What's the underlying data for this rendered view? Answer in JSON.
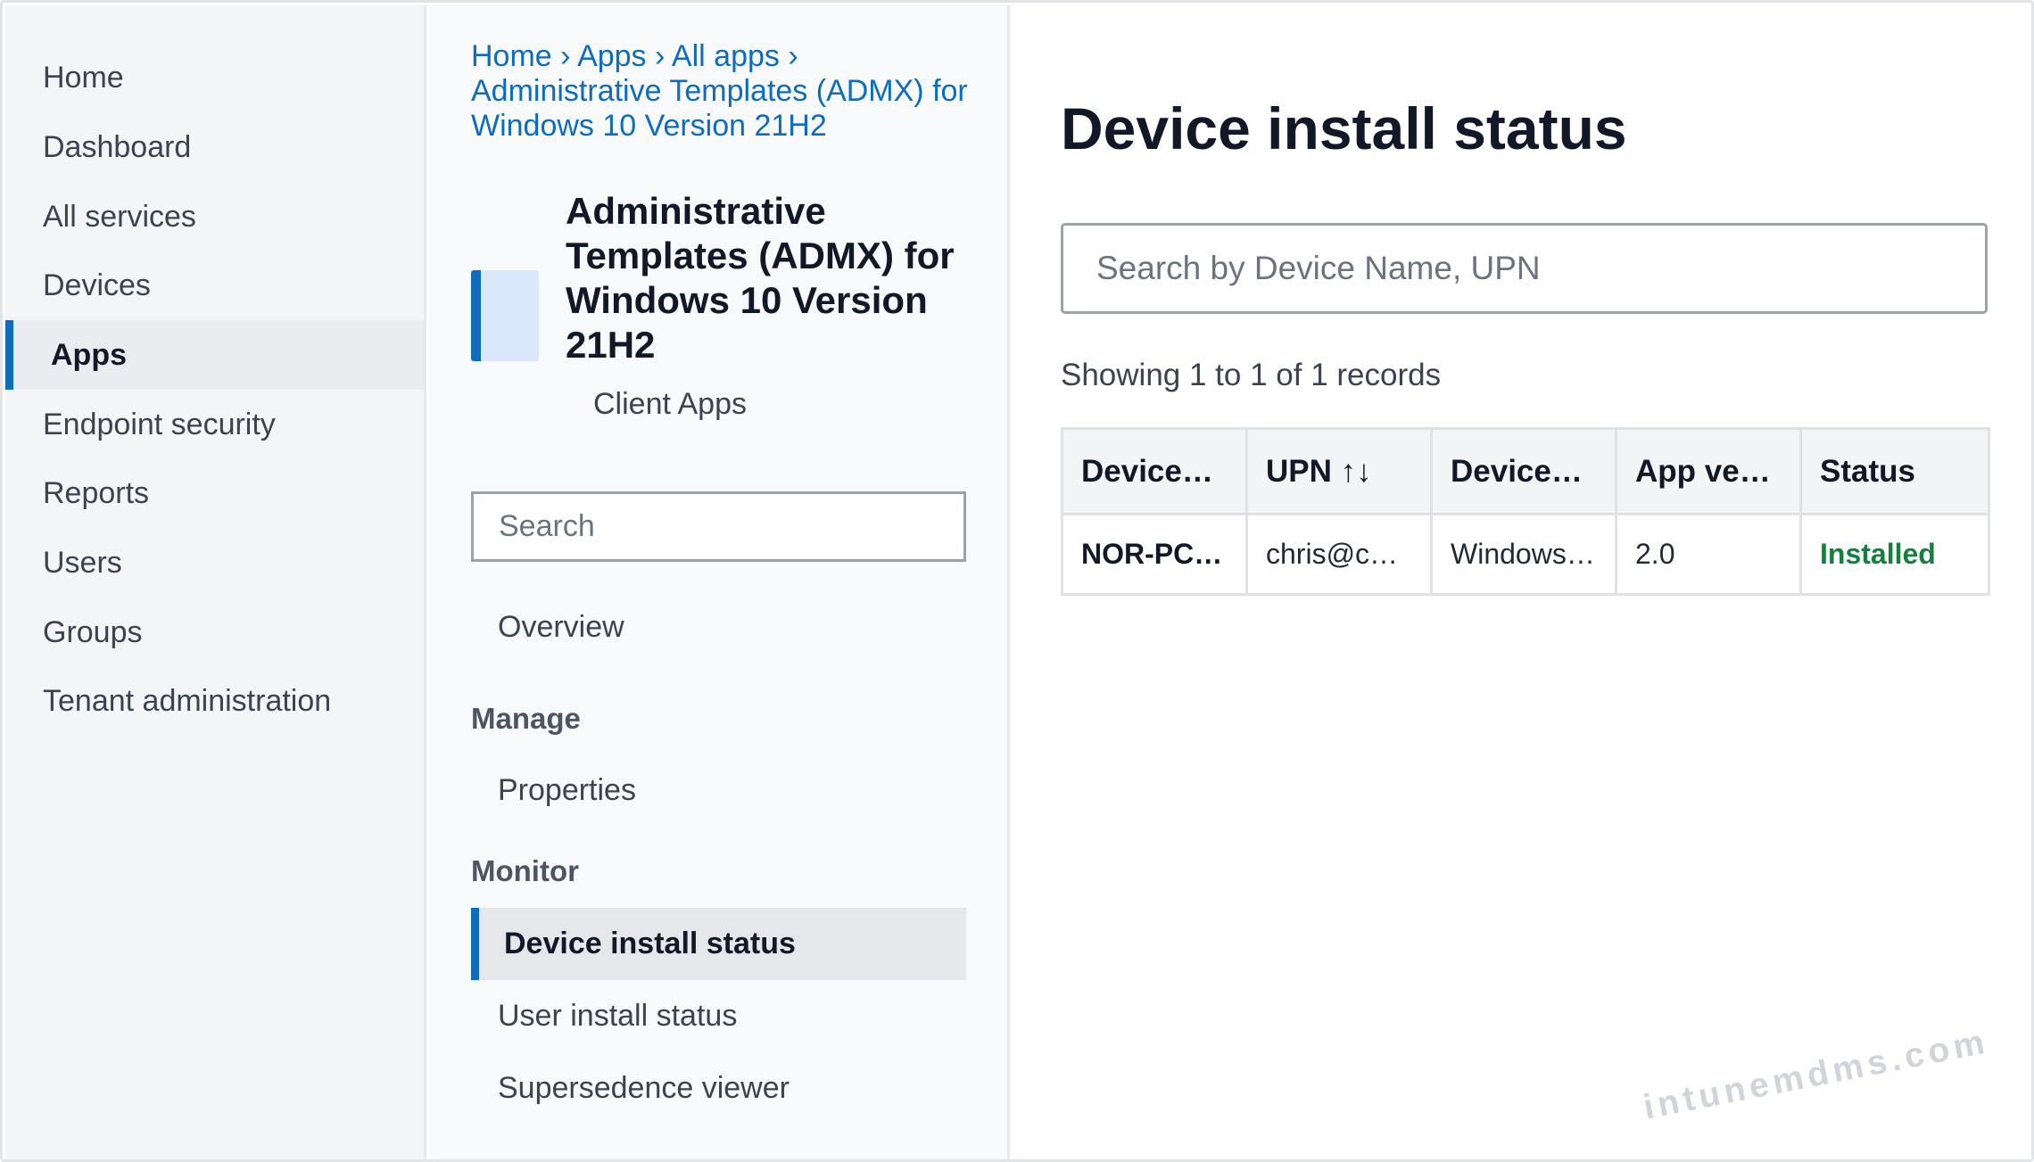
{
  "nav": {
    "items": [
      {
        "label": "Home"
      },
      {
        "label": "Dashboard"
      },
      {
        "label": "All services"
      },
      {
        "label": "Devices"
      },
      {
        "label": "Apps",
        "active": true
      },
      {
        "label": "Endpoint security"
      },
      {
        "label": "Reports"
      },
      {
        "label": "Users"
      },
      {
        "label": "Groups"
      },
      {
        "label": "Tenant administration"
      }
    ]
  },
  "breadcrumb": {
    "items": [
      "Home",
      "Apps",
      "All apps",
      "Administrative Templates (ADMX) for Windows 10 Version 21H2"
    ],
    "separator": "›"
  },
  "app": {
    "title": "Administrative Templates (ADMX) for Windows 10 Version 21H2",
    "subtitle": "Client Apps",
    "tile_color": "#dbe8fb"
  },
  "blade_menu": {
    "search_placeholder": "Search",
    "overview": "Overview",
    "manage_heading": "Manage",
    "properties": "Properties",
    "monitor_heading": "Monitor",
    "device_install_status": "Device install status",
    "user_install_status": "User install status",
    "supersedence_viewer": "Supersedence viewer"
  },
  "main": {
    "title": "Device install status",
    "search_placeholder": "Search by Device Name, UPN",
    "records_text": "Showing 1 to 1 of 1 records",
    "columns": [
      "Device…",
      "UPN ↑↓",
      "Device…",
      "App ve…",
      "Status"
    ],
    "rows": [
      [
        "NOR-PC…",
        "chris@c…",
        "Windows…",
        "2.0",
        "Installed"
      ]
    ]
  },
  "watermark": "intunemdms.com",
  "colors": {
    "accent": "#0f6cbd",
    "status_installed": "#15803d"
  }
}
